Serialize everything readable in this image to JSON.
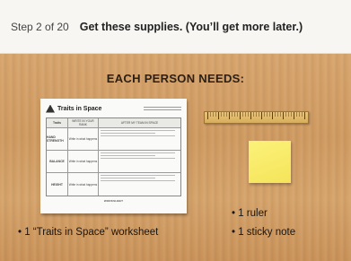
{
  "header": {
    "step": "Step 2 of 20",
    "title": "Get these supplies. (You’ll get more later.)"
  },
  "main": {
    "heading": "EACH PERSON NEEDS:",
    "items": [
      "• 1 “Traits in Space” worksheet",
      "• 1 ruler",
      "• 1 sticky note"
    ]
  },
  "worksheet": {
    "title": "Traits in Space",
    "col1": "Traits",
    "col2": "WRITE IN YOUR RANK",
    "col3": "AFTER MY TEAM IN SPACE",
    "rows": [
      "HAND STRENGTH",
      "BALANCE",
      "HEIGHT"
    ],
    "row_prompt": "Write in what happens",
    "footer": "WORKSHEET"
  },
  "colors": {
    "board": "#d3a066",
    "sticky_note": "#f8ea66",
    "ruler": "#e0b86a"
  }
}
